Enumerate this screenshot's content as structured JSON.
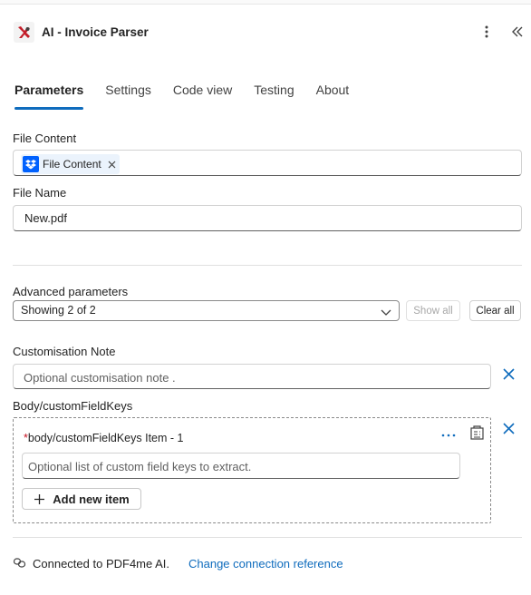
{
  "header": {
    "title": "AI - Invoice Parser"
  },
  "tabs": [
    {
      "label": "Parameters",
      "active": true
    },
    {
      "label": "Settings",
      "active": false
    },
    {
      "label": "Code view",
      "active": false
    },
    {
      "label": "Testing",
      "active": false
    },
    {
      "label": "About",
      "active": false
    }
  ],
  "file_content": {
    "label": "File Content",
    "token": "File Content"
  },
  "file_name": {
    "label": "File Name",
    "value": "New.pdf"
  },
  "advanced": {
    "label": "Advanced parameters",
    "selected": "Showing 2 of 2",
    "show_all": "Show all",
    "clear_all": "Clear all"
  },
  "customisation_note": {
    "label": "Customisation Note",
    "placeholder": "Optional customisation note ."
  },
  "custom_field_keys": {
    "label": "Body/customFieldKeys",
    "required_mark": "*",
    "item_label": "body/customFieldKeys Item - 1",
    "placeholder": "Optional list of custom field keys to extract.",
    "add_item": "Add new item"
  },
  "footer": {
    "connected_text": "Connected to PDF4me AI.",
    "change_link": "Change connection reference"
  },
  "colors": {
    "accent": "#0f6cbd",
    "required": "#c50f1f",
    "token_bg": "#ebf3fc",
    "dropbox": "#0061fe"
  }
}
